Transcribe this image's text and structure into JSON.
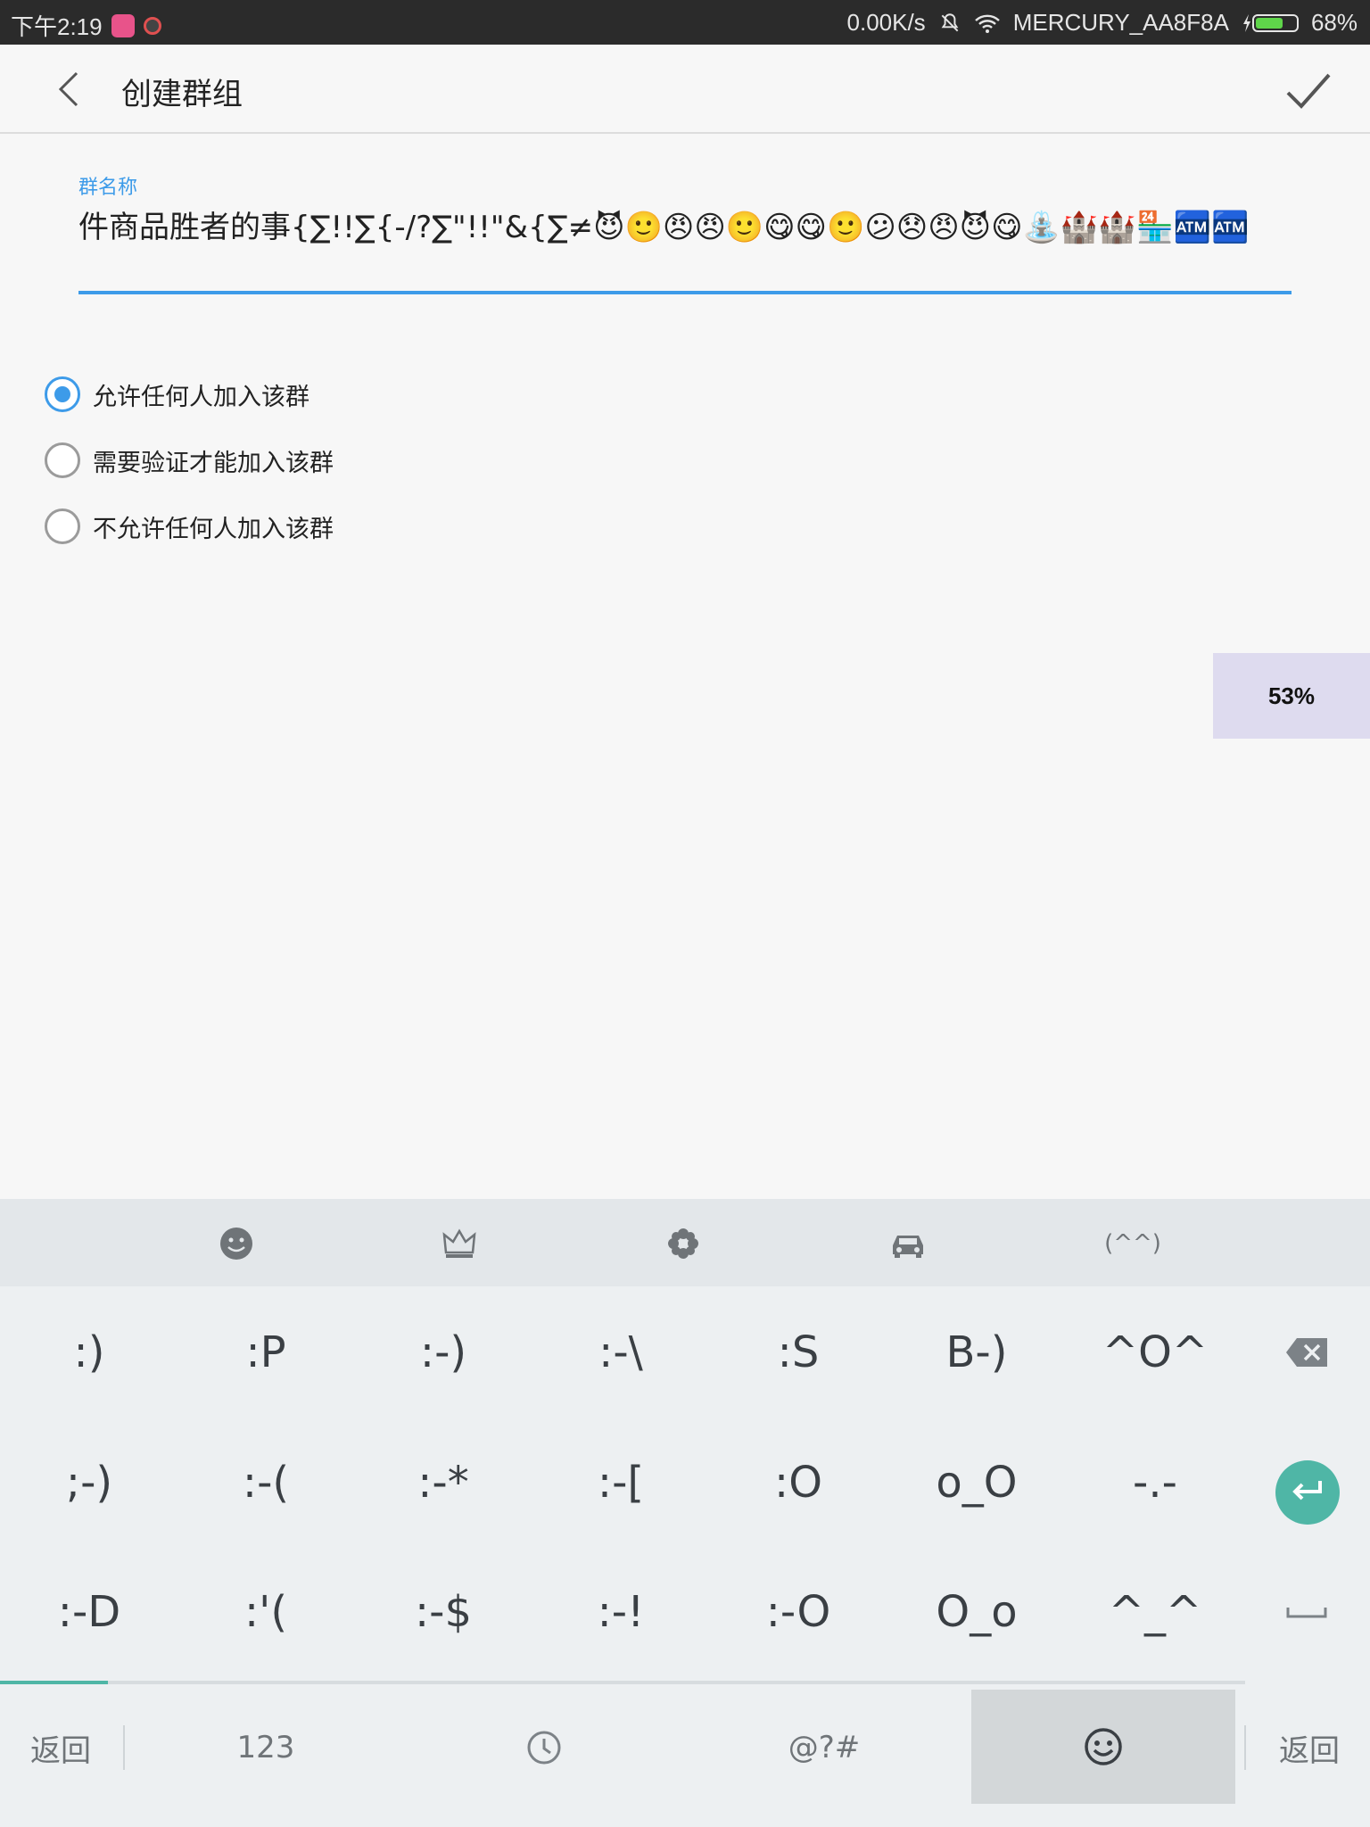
{
  "status_bar": {
    "time": "下午2:19",
    "net_speed": "0.00K/s",
    "wifi_name": "MERCURY_AA8F8A",
    "battery": "68%",
    "battery_level": 0.68
  },
  "app_bar": {
    "title": "创建群组"
  },
  "form": {
    "name_label": "群名称",
    "name_value": "件商品胜者的事{∑!!∑{-/?∑\"!!\"&{∑≠😈🙂😠😠🙂😋😋🙂😕😞😠😈😋⛲🏰🏰🏪🏧🏧"
  },
  "options": [
    {
      "label": "允许任何人加入该群",
      "checked": true
    },
    {
      "label": "需要验证才能加入该群",
      "checked": false
    },
    {
      "label": "不允许任何人加入该群",
      "checked": false
    }
  ],
  "progress_badge": "53%",
  "keyboard": {
    "categories": [
      "smiley-icon",
      "crown-icon",
      "flower-icon",
      "car-icon",
      "(^^)"
    ],
    "rows": [
      [
        ":)",
        ":P",
        ":-)",
        ":-\\",
        ":S",
        "B-)",
        "^O^"
      ],
      [
        ";-)",
        ":-(",
        ":-*",
        ":-[",
        ":O",
        "o_O",
        "-.-"
      ],
      [
        ":-D",
        ":'(",
        ":-$",
        ":-!",
        ":-O",
        "O_o",
        "^_^"
      ]
    ],
    "bottom": {
      "back_left": "返回",
      "numbers": "123",
      "symbols": "@?#",
      "back_right": "返回"
    },
    "active_tab_fraction": 0.087
  }
}
